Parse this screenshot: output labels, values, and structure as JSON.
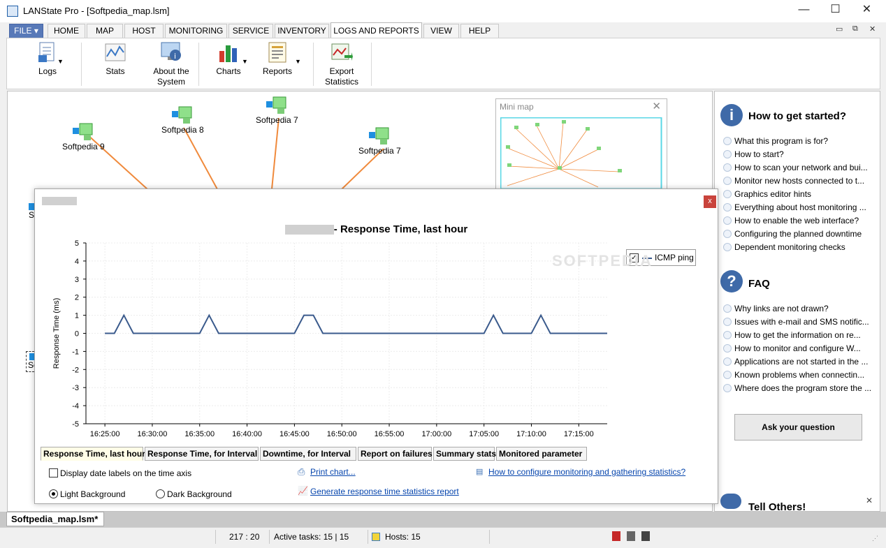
{
  "window": {
    "title": "LANState Pro - [Softpedia_map.lsm]",
    "minimize": "—",
    "maximize": "☐",
    "close": "✕"
  },
  "menu": {
    "file": "FILE",
    "tabs": [
      "HOME",
      "MAP",
      "HOST",
      "MONITORING",
      "SERVICE",
      "INVENTORY",
      "LOGS AND REPORTS",
      "VIEW",
      "HELP"
    ],
    "active_tab": "LOGS AND REPORTS",
    "mdi_controls": [
      "▭",
      "⧉",
      "✕"
    ]
  },
  "ribbon": {
    "logs": "Logs",
    "stats": "Stats",
    "about_system": "About the System",
    "charts": "Charts",
    "reports": "Reports",
    "export_statistics": "Export Statistics"
  },
  "map": {
    "hosts": [
      "Softpedia 9",
      "Softpedia 8",
      "Softpedia 7",
      "Softpedia 7",
      "S",
      "So"
    ],
    "link_color": "#f08a3c"
  },
  "minimap": {
    "title": "Mini map",
    "close": "✕"
  },
  "dialog": {
    "close": "x",
    "chart_title_suffix": "- Response Time, last hour",
    "legend_label": "ICMP ping",
    "tabs": [
      "Response Time, last hour",
      "Response Time, for Interval",
      "Downtime, for Interval",
      "Report on failures",
      "Summary stats",
      "Monitored parameter"
    ],
    "date_labels_checkbox": "Display date labels on the time axis",
    "light_background": "Light Background",
    "dark_background": "Dark Background",
    "print_chart": "Print chart...",
    "generate_report": "Generate response time statistics report",
    "how_to_configure": "How to configure monitoring and gathering statistics?"
  },
  "chart_data": {
    "type": "line",
    "title": "- Response Time, last hour",
    "ylabel": "Response Time (ms)",
    "xlabel": "",
    "ylim": [
      -5,
      5
    ],
    "yticks": [
      "5",
      "4",
      "3",
      "2",
      "1",
      "0",
      "-1",
      "-2",
      "-3",
      "-4",
      "-5"
    ],
    "xticks": [
      "16:25:00",
      "16:30:00",
      "16:35:00",
      "16:40:00",
      "16:45:00",
      "16:50:00",
      "16:55:00",
      "17:00:00",
      "17:05:00",
      "17:10:00",
      "17:15:00"
    ],
    "grid": true,
    "legend": "top-right",
    "series": [
      {
        "name": "ICMP ping",
        "color": "#3a5a8c",
        "x": [
          "16:25:00",
          "16:26:00",
          "16:27:00",
          "16:28:00",
          "16:30:00",
          "16:35:00",
          "16:36:00",
          "16:37:00",
          "16:38:00",
          "16:40:00",
          "16:45:00",
          "16:46:00",
          "16:47:00",
          "16:48:00",
          "16:49:00",
          "16:55:00",
          "17:00:00",
          "17:05:00",
          "17:06:00",
          "17:07:00",
          "17:08:00",
          "17:10:00",
          "17:11:00",
          "17:12:00",
          "17:13:00",
          "17:18:00"
        ],
        "values": [
          0,
          0,
          1,
          0,
          0,
          0,
          1,
          0,
          0,
          0,
          0,
          1,
          1,
          0,
          0,
          0,
          0,
          0,
          1,
          0,
          0,
          0,
          1,
          0,
          0,
          0
        ]
      }
    ]
  },
  "help_panel": {
    "get_started_title": "How to get started?",
    "get_started_items": [
      "What this program is for?",
      "How to start?",
      "How to scan your network and bui...",
      "Monitor new hosts connected to t...",
      "Graphics editor hints",
      "Everything about host monitoring ...",
      "How to enable the web interface?",
      "Configuring the planned downtime",
      "Dependent monitoring checks"
    ],
    "faq_title": "FAQ",
    "faq_items": [
      "Why links are not drawn?",
      "Issues with e-mail and SMS notific...",
      "How to get the information on re...",
      "How to monitor and configure W...",
      "Applications are not started in the ...",
      "Known problems when connectin...",
      "Where does the program store the ..."
    ],
    "ask_button": "Ask your question",
    "tell_others": "Tell Others!",
    "close": "✕"
  },
  "document_tab": "Softpedia_map.lsm*",
  "status": {
    "coords": "217 : 20",
    "active_tasks": "Active tasks: 15 | 15",
    "hosts": "Hosts: 15"
  },
  "watermark": "SOFTPEDIA"
}
